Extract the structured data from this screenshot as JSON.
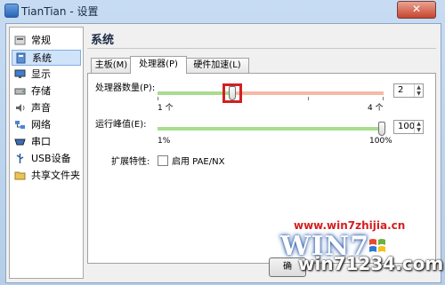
{
  "window": {
    "title": "TianTian - 设置"
  },
  "sidebar": {
    "items": [
      {
        "label": "常规",
        "icon": "general-icon",
        "selected": false
      },
      {
        "label": "系统",
        "icon": "system-icon",
        "selected": true
      },
      {
        "label": "显示",
        "icon": "display-icon",
        "selected": false
      },
      {
        "label": "存储",
        "icon": "storage-icon",
        "selected": false
      },
      {
        "label": "声音",
        "icon": "audio-icon",
        "selected": false
      },
      {
        "label": "网络",
        "icon": "network-icon",
        "selected": false
      },
      {
        "label": "串口",
        "icon": "serial-port-icon",
        "selected": false
      },
      {
        "label": "USB设备",
        "icon": "usb-icon",
        "selected": false
      },
      {
        "label": "共享文件夹",
        "icon": "shared-folder-icon",
        "selected": false
      }
    ]
  },
  "panel": {
    "title": "系统",
    "tabs": [
      {
        "label": "主板(M)",
        "active": false
      },
      {
        "label": "处理器(P)",
        "active": true
      },
      {
        "label": "硬件加速(L)",
        "active": false
      }
    ],
    "processor_count": {
      "label": "处理器数量(P):",
      "value": "2",
      "min_label": "1 个",
      "max_label": "4 个",
      "fraction": 0.33
    },
    "execution_cap": {
      "label": "运行峰值(E):",
      "value": "100",
      "min_label": "1%",
      "max_label": "100%",
      "fraction": 1.0
    },
    "extended_features": {
      "label": "扩展特性:",
      "pae_label": "启用 PAE/NX",
      "pae_checked": false
    }
  },
  "buttons": {
    "ok": "确"
  },
  "watermark": {
    "url": "www.win7zhijia.cn",
    "logo_text": "WIN7",
    "site": "win71234.com"
  },
  "colors": {
    "highlight": "#d32020",
    "slider_green": "#a8dc8f",
    "slider_red": "#f5b9a6"
  }
}
